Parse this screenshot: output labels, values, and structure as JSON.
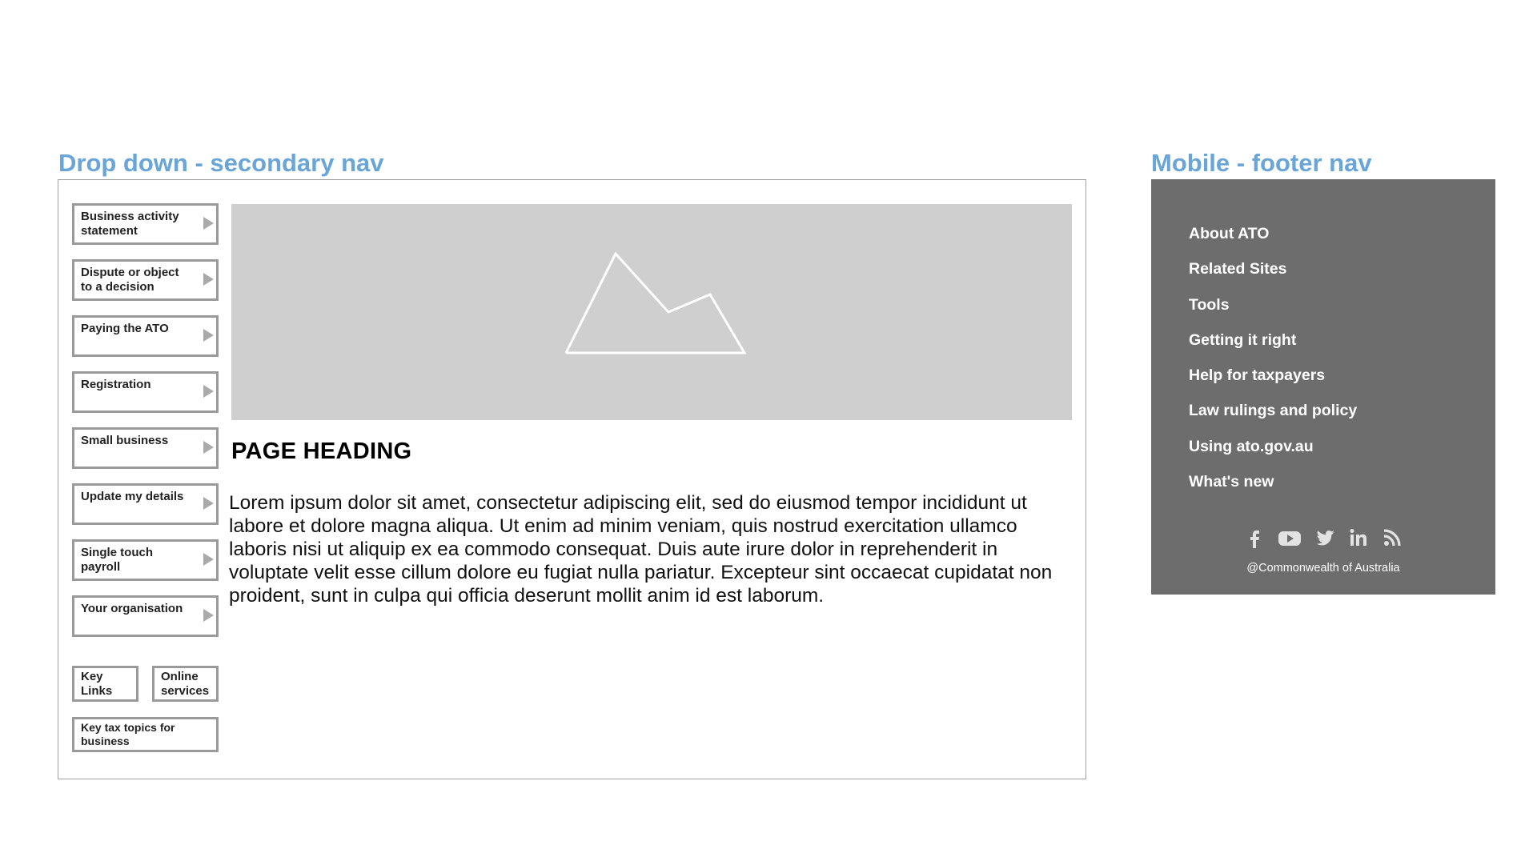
{
  "sections": {
    "left_title": "Drop down - secondary nav",
    "right_title": "Mobile - footer nav"
  },
  "secondary_nav": {
    "items": [
      {
        "label": "Business activity statement"
      },
      {
        "label": "Dispute or object to a decision"
      },
      {
        "label": "Paying the ATO"
      },
      {
        "label": "Registration"
      },
      {
        "label": "Small business"
      },
      {
        "label": "Update my details"
      },
      {
        "label": "Single touch payroll"
      },
      {
        "label": "Your organisation"
      }
    ],
    "key_links": "Key Links",
    "online_services": "Online services",
    "key_tax_topics": "Key tax topics for business"
  },
  "main": {
    "hero_image": "image-placeholder-icon",
    "heading": "PAGE HEADING",
    "body": "Lorem ipsum dolor sit amet, consectetur adipiscing elit, sed do eiusmod tempor incididunt ut labore et dolore magna aliqua. Ut enim ad minim veniam, quis nostrud exercitation ullamco laboris nisi ut aliquip ex ea commodo consequat. Duis aute irure dolor in reprehenderit in voluptate velit esse cillum dolore eu fugiat nulla pariatur. Excepteur sint occaecat cupidatat non proident, sunt in culpa qui officia deserunt mollit anim id est laborum."
  },
  "footer": {
    "links": [
      "About ATO",
      "Related Sites",
      "Tools",
      "Getting it right",
      "Help for taxpayers",
      "Law rulings and policy",
      "Using ato.gov.au",
      "What's new"
    ],
    "social_icons": [
      "facebook-icon",
      "youtube-icon",
      "twitter-icon",
      "linkedin-icon",
      "rss-icon"
    ],
    "copyright": "@Commonwealth of Australia"
  },
  "colors": {
    "accent": "#6aa5d8",
    "footer_bg": "#6d6d6d",
    "placeholder_bg": "#cfcfcf",
    "border": "#9a9a9a"
  }
}
